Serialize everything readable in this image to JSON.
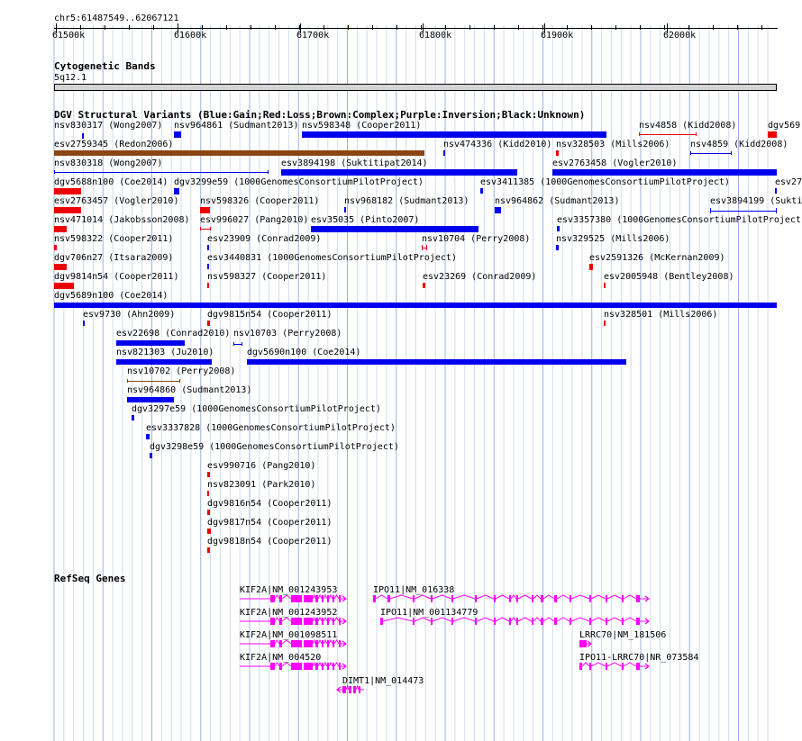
{
  "ruler": {
    "location": "chr5:61487549..62067121",
    "ticks": [
      {
        "label": "61500k"
      },
      {
        "label": "61600k"
      },
      {
        "label": "61700k"
      },
      {
        "label": "61800k"
      },
      {
        "label": "61900k"
      },
      {
        "label": "62000k"
      }
    ]
  },
  "tracks": {
    "cytoband": {
      "title": "Cytogenetic Bands",
      "band": "5q12.1"
    },
    "dgv": {
      "title": "DGV Structural Variants (Blue:Gain;Red:Loss;Brown:Complex;Purple:Inversion;Black:Unknown)"
    },
    "refseq": {
      "title": "RefSeq Genes"
    }
  },
  "colors": {
    "gain": "#0000ee",
    "loss": "#ee0000",
    "complex": "#8b4513",
    "gene": "#ff00ff",
    "grid": "#b0c8e8"
  },
  "variants": [
    {
      "label": "nsv830317 (Wong2007)",
      "type": "gain"
    },
    {
      "label": "nsv964861 (Sudmant2013)",
      "type": "gain"
    },
    {
      "label": "nsv598348 (Cooper2011)",
      "type": "gain"
    },
    {
      "label": "nsv4858 (Kidd2008)",
      "type": "loss"
    },
    {
      "label": "dgv569",
      "type": "loss"
    },
    {
      "label": "esv2759345 (Redon2006)",
      "type": "complex"
    },
    {
      "label": "nsv474336 (Kidd2010)",
      "type": "gain"
    },
    {
      "label": "nsv328503 (Mills2006)",
      "type": "loss"
    },
    {
      "label": "nsv4859 (Kidd2008)",
      "type": "gain"
    },
    {
      "label": "nsv830318 (Wong2007)",
      "type": "gain"
    },
    {
      "label": "esv3894198 (Suktitipat2014)",
      "type": "gain"
    },
    {
      "label": "esv2763458 (Vogler2010)",
      "type": "gain"
    },
    {
      "label": "dgv5688n100 (Coe2014)",
      "type": "loss"
    },
    {
      "label": "dgv3299e59 (1000GenomesConsortiumPilotProject)",
      "type": "gain"
    },
    {
      "label": "esv3411385 (1000GenomesConsortiumPilotProject)",
      "type": "gain"
    },
    {
      "label": "esv27",
      "type": "gain"
    },
    {
      "label": "esv2763457 (Vogler2010)",
      "type": "loss"
    },
    {
      "label": "nsv598326 (Cooper2011)",
      "type": "loss"
    },
    {
      "label": "nsv968182 (Sudmant2013)",
      "type": "gain"
    },
    {
      "label": "nsv964862 (Sudmant2013)",
      "type": "gain"
    },
    {
      "label": "esv3894199 (Sukti",
      "type": "gain"
    },
    {
      "label": "nsv471014 (Jakobsson2008)",
      "type": "loss"
    },
    {
      "label": "esv996027 (Pang2010)",
      "type": "loss"
    },
    {
      "label": "esv35035 (Pinto2007)",
      "type": "gain"
    },
    {
      "label": "esv3357380 (1000GenomesConsortiumPilotProject)",
      "type": "gain"
    },
    {
      "label": "nsv598322 (Cooper2011)",
      "type": "loss"
    },
    {
      "label": "esv23909 (Conrad2009)",
      "type": "gain"
    },
    {
      "label": "nsv10704 (Perry2008)",
      "type": "loss"
    },
    {
      "label": "nsv329525 (Mills2006)",
      "type": "gain"
    },
    {
      "label": "dgv706n27 (Itsara2009)",
      "type": "loss"
    },
    {
      "label": "esv3440831 (1000GenomesConsortiumPilotProject)",
      "type": "gain"
    },
    {
      "label": "esv2591326 (McKernan2009)",
      "type": "loss"
    },
    {
      "label": "dgv9814n54 (Cooper2011)",
      "type": "loss"
    },
    {
      "label": "nsv598327 (Cooper2011)",
      "type": "loss"
    },
    {
      "label": "esv23269 (Conrad2009)",
      "type": "loss"
    },
    {
      "label": "esv2005948 (Bentley2008)",
      "type": "loss"
    },
    {
      "label": "dgv5689n100 (Coe2014)",
      "type": "gain"
    },
    {
      "label": "esv9730 (Ahn2009)",
      "type": "gain"
    },
    {
      "label": "dgv9815n54 (Cooper2011)",
      "type": "loss"
    },
    {
      "label": "nsv328501 (Mills2006)",
      "type": "loss"
    },
    {
      "label": "esv22698 (Conrad2010)",
      "type": "gain"
    },
    {
      "label": "nsv10703 (Perry2008)",
      "type": "gain"
    },
    {
      "label": "nsv821303 (Ju2010)",
      "type": "gain"
    },
    {
      "label": "dgv5690n100 (Coe2014)",
      "type": "gain"
    },
    {
      "label": "nsv10702 (Perry2008)",
      "type": "complex"
    },
    {
      "label": "nsv964860 (Sudmant2013)",
      "type": "gain"
    },
    {
      "label": "dgv3297e59 (1000GenomesConsortiumPilotProject)",
      "type": "gain"
    },
    {
      "label": "esv3337828 (1000GenomesConsortiumPilotProject)",
      "type": "gain"
    },
    {
      "label": "dgv3298e59 (1000GenomesConsortiumPilotProject)",
      "type": "gain"
    },
    {
      "label": "esv990716 (Pang2010)",
      "type": "loss"
    },
    {
      "label": "nsv823091 (Park2010)",
      "type": "loss"
    },
    {
      "label": "dgv9816n54 (Cooper2011)",
      "type": "loss"
    },
    {
      "label": "dgv9817n54 (Cooper2011)",
      "type": "loss"
    },
    {
      "label": "dgv9818n54 (Cooper2011)",
      "type": "loss"
    }
  ],
  "genes": [
    {
      "label": "KIF2A|NM_001243953"
    },
    {
      "label": "IPO11|NM_016338"
    },
    {
      "label": "KIF2A|NM_001243952"
    },
    {
      "label": "IPO11|NM_001134779"
    },
    {
      "label": "KIF2A|NM_001098511"
    },
    {
      "label": "LRRC70|NM_181506"
    },
    {
      "label": "KIF2A|NM_004520"
    },
    {
      "label": "IPO11-LRRC70|NR_073584"
    },
    {
      "label": "DIMT1|NM_014473"
    }
  ]
}
